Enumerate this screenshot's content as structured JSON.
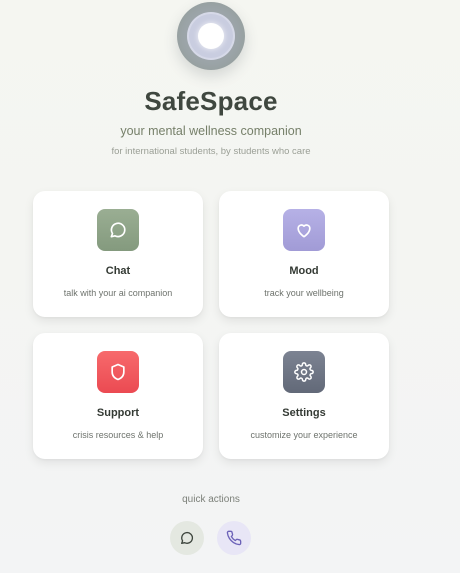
{
  "app": {
    "title": "SafeSpace",
    "tagline": "your mental wellness companion",
    "subtagline": "for international students, by students who care"
  },
  "cards": [
    {
      "title": "Chat",
      "description": "talk with your ai companion",
      "icon": "chat-bubble-icon",
      "color": "#8ea287"
    },
    {
      "title": "Mood",
      "description": "track your wellbeing",
      "icon": "heart-icon",
      "color": "#a9a3dc"
    },
    {
      "title": "Support",
      "description": "crisis resources & help",
      "icon": "shield-icon",
      "color": "#f1585c"
    },
    {
      "title": "Settings",
      "description": "customize your experience",
      "icon": "gear-icon",
      "color": "#6e7584"
    }
  ],
  "quick_actions": {
    "label": "quick actions",
    "buttons": [
      {
        "icon": "chat-bubble-icon",
        "color": "#e4e8e1"
      },
      {
        "icon": "phone-icon",
        "color": "#e8e6f6"
      }
    ]
  }
}
